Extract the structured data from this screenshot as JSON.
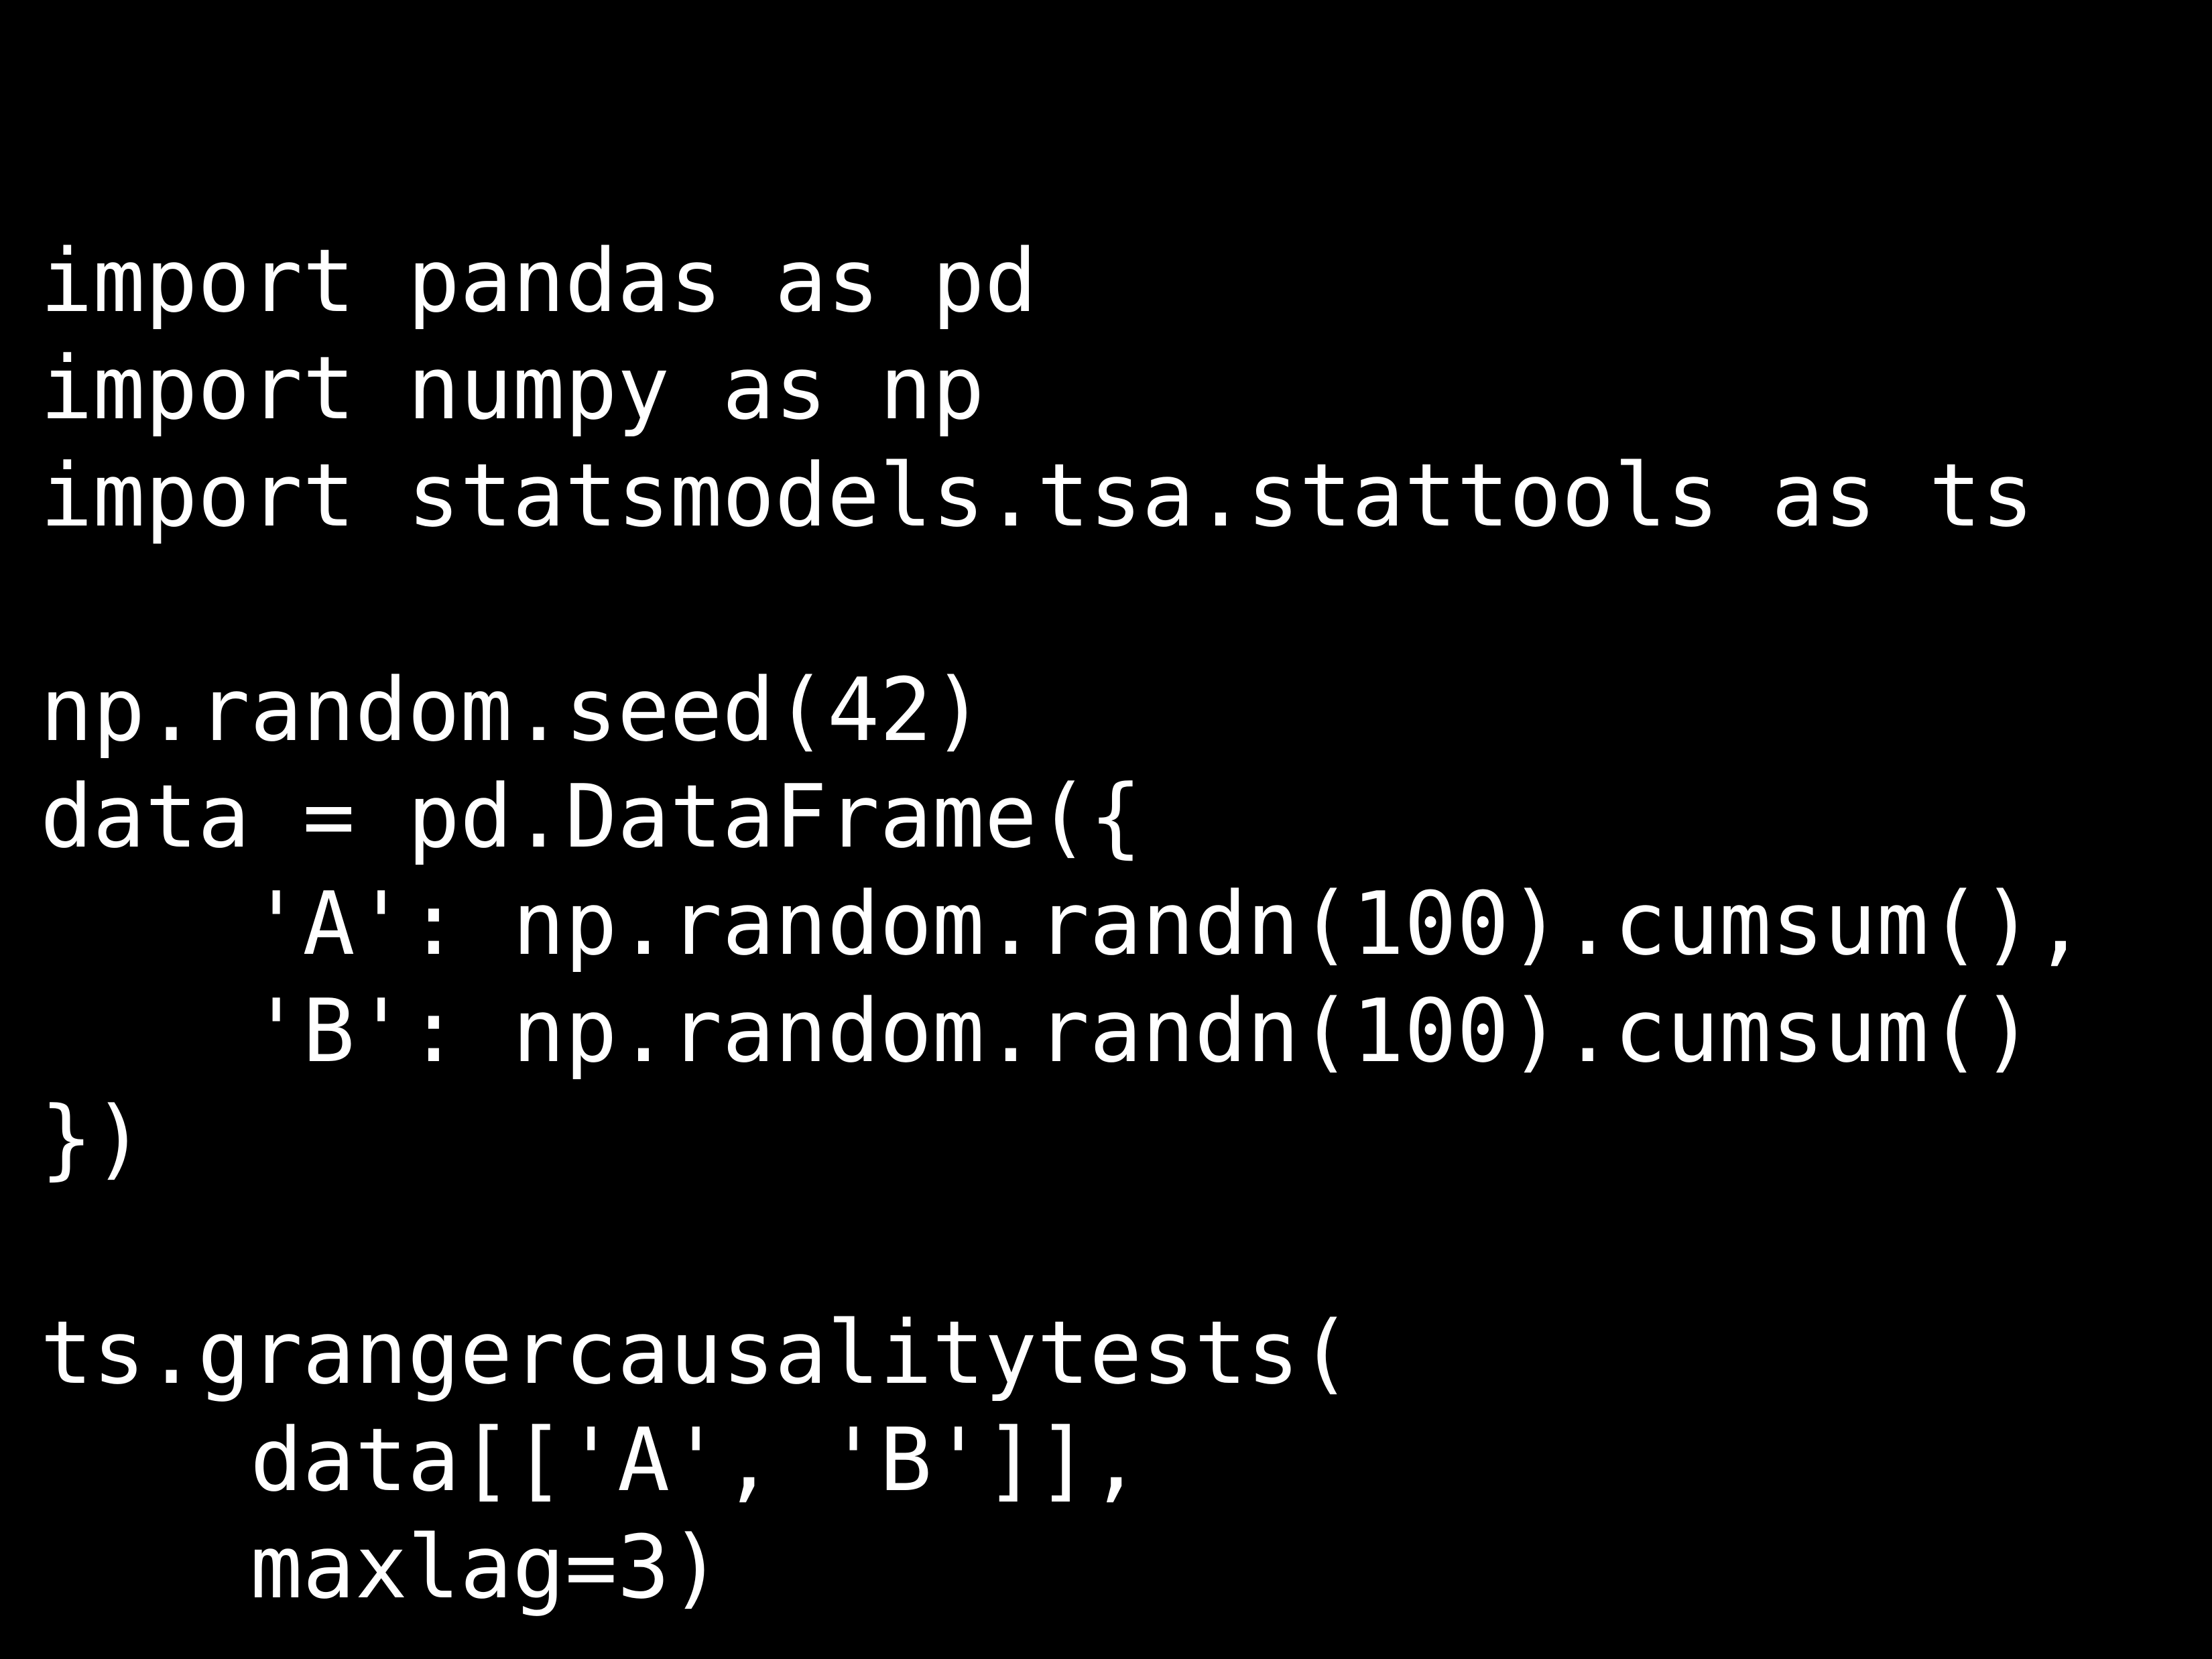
{
  "code": {
    "lines": [
      "import pandas as pd",
      "import numpy as np",
      "import statsmodels.tsa.stattools as ts",
      "",
      "np.random.seed(42)",
      "data = pd.DataFrame({",
      "    'A': np.random.randn(100).cumsum(),",
      "    'B': np.random.randn(100).cumsum()",
      "})",
      "",
      "ts.grangercausalitytests(",
      "    data[['A', 'B']],",
      "    maxlag=3)"
    ]
  }
}
